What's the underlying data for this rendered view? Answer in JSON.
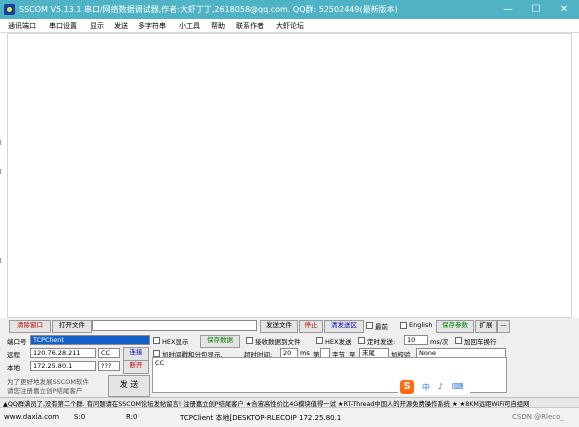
{
  "titlebar": {
    "text": "SSCOM V5.13.1 串口/网络数据调试器,作者:大虾丁丁,2618058@qq.com. QQ群: 52502449(最新版本)",
    "minimize": "—",
    "maximize": "☐",
    "close": "✕"
  },
  "menu": [
    "通讯端口",
    "串口设置",
    "显示",
    "发送",
    "多字符串",
    "小工具",
    "帮助",
    "联系作者",
    "大虾论坛"
  ],
  "leftstrip": [
    "l",
    "l",
    "l"
  ],
  "row1": {
    "clear_window": "清除窗口",
    "open_file": "打开文件",
    "send_file": "发送文件",
    "stop": "停止",
    "send_area_clear": "清发送区",
    "topmost": "最前",
    "english": "English",
    "save_params": "保存参数",
    "expand": "扩展",
    "dash": "—"
  },
  "row2": {
    "port_label": "端口号",
    "port_value": "TCPClient",
    "hex_display": "HEX显示",
    "save_data": "保存数据",
    "recv_to_file": "接收数据到文件",
    "hex_send": "HEX发送",
    "timed_send": "定时发送:",
    "interval": "10",
    "unit": "ms/次",
    "add_crlf": "加回车换行"
  },
  "row3": {
    "remote_label": "远程",
    "remote_ip": "120.76.28.211",
    "remote_port": "CC",
    "connect": "连接",
    "timestamp": "加时间戳和分包显示,",
    "timeout_label": "超时时间:",
    "timeout_value": "20",
    "ms": "ms",
    "byte_label": "第",
    "byte_unit": "字节",
    "to": "至",
    "end": "末尾",
    "verify": "加校验",
    "verify_value": "None"
  },
  "row4": {
    "local_label": "本地",
    "local_ip": "172.25.80.1",
    "local_port": "???",
    "disconnect": "断开",
    "send_text": "CC"
  },
  "promo": {
    "line1": "为了更好地发展SSCOM软件",
    "line2": "请您注册嘉立创P结尾客户",
    "send_button": "发 送"
  },
  "ime": {
    "logo": "S",
    "items": [
      "中",
      "♪",
      "⌨"
    ]
  },
  "statusbar": {
    "text": "▲QQ群满员了,没有第二个群. 有问题请在SSCOM论坛发帖留言! 注册嘉立创P结尾客户 ★合宙高性价比4G模块值得一试 ★RT-Thread中国人的开源免费操作系统 ★ ★8KM远距WiFi可自组网"
  },
  "bottombar": {
    "website": "www.daxia.com",
    "s": "S:0",
    "r": "R:0",
    "client_info": "TCPClient 本地[DESKTOP-RLECOIP 172.25.80.1",
    "watermark": "CSDN @Rleco_"
  },
  "colors": {
    "titlebar": "#4fb3c5",
    "panel": "#efefef",
    "ime_logo": "#ff6a13"
  }
}
